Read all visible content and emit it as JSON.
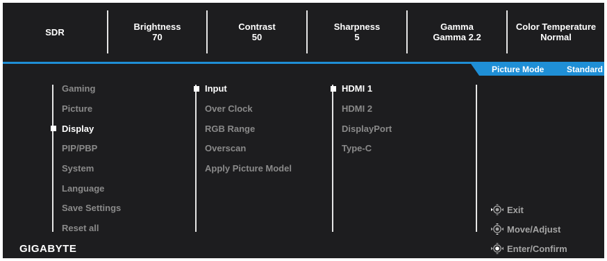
{
  "status_bar": {
    "mode": "SDR",
    "brightness": {
      "label": "Brightness",
      "value": "70"
    },
    "contrast": {
      "label": "Contrast",
      "value": "50"
    },
    "sharpness": {
      "label": "Sharpness",
      "value": "5"
    },
    "gamma": {
      "label": "Gamma",
      "value": "Gamma 2.2"
    },
    "color_temperature": {
      "label": "Color Temperature",
      "value": "Normal"
    }
  },
  "picture_mode": {
    "label": "Picture Mode",
    "value": "Standard"
  },
  "main_menu": {
    "items": [
      "Gaming",
      "Picture",
      "Display",
      "PIP/PBP",
      "System",
      "Language",
      "Save Settings",
      "Reset all"
    ],
    "selected": "Display"
  },
  "sub_menu": {
    "items": [
      "Input",
      "Over Clock",
      "RGB Range",
      "Overscan",
      "Apply Picture Model"
    ],
    "selected": "Input"
  },
  "options_menu": {
    "items": [
      "HDMI 1",
      "HDMI 2",
      "DisplayPort",
      "Type-C"
    ],
    "selected": "HDMI 1"
  },
  "controls": {
    "exit": "Exit",
    "move_adjust": "Move/Adjust",
    "enter_confirm": "Enter/Confirm"
  },
  "brand": "GIGABYTE",
  "colors": {
    "accent": "#1f8fd6",
    "background": "#1d1d1f",
    "active_text": "#ffffff",
    "inactive_text": "#8a8a8a"
  },
  "icons": [
    "joystick-icon"
  ]
}
